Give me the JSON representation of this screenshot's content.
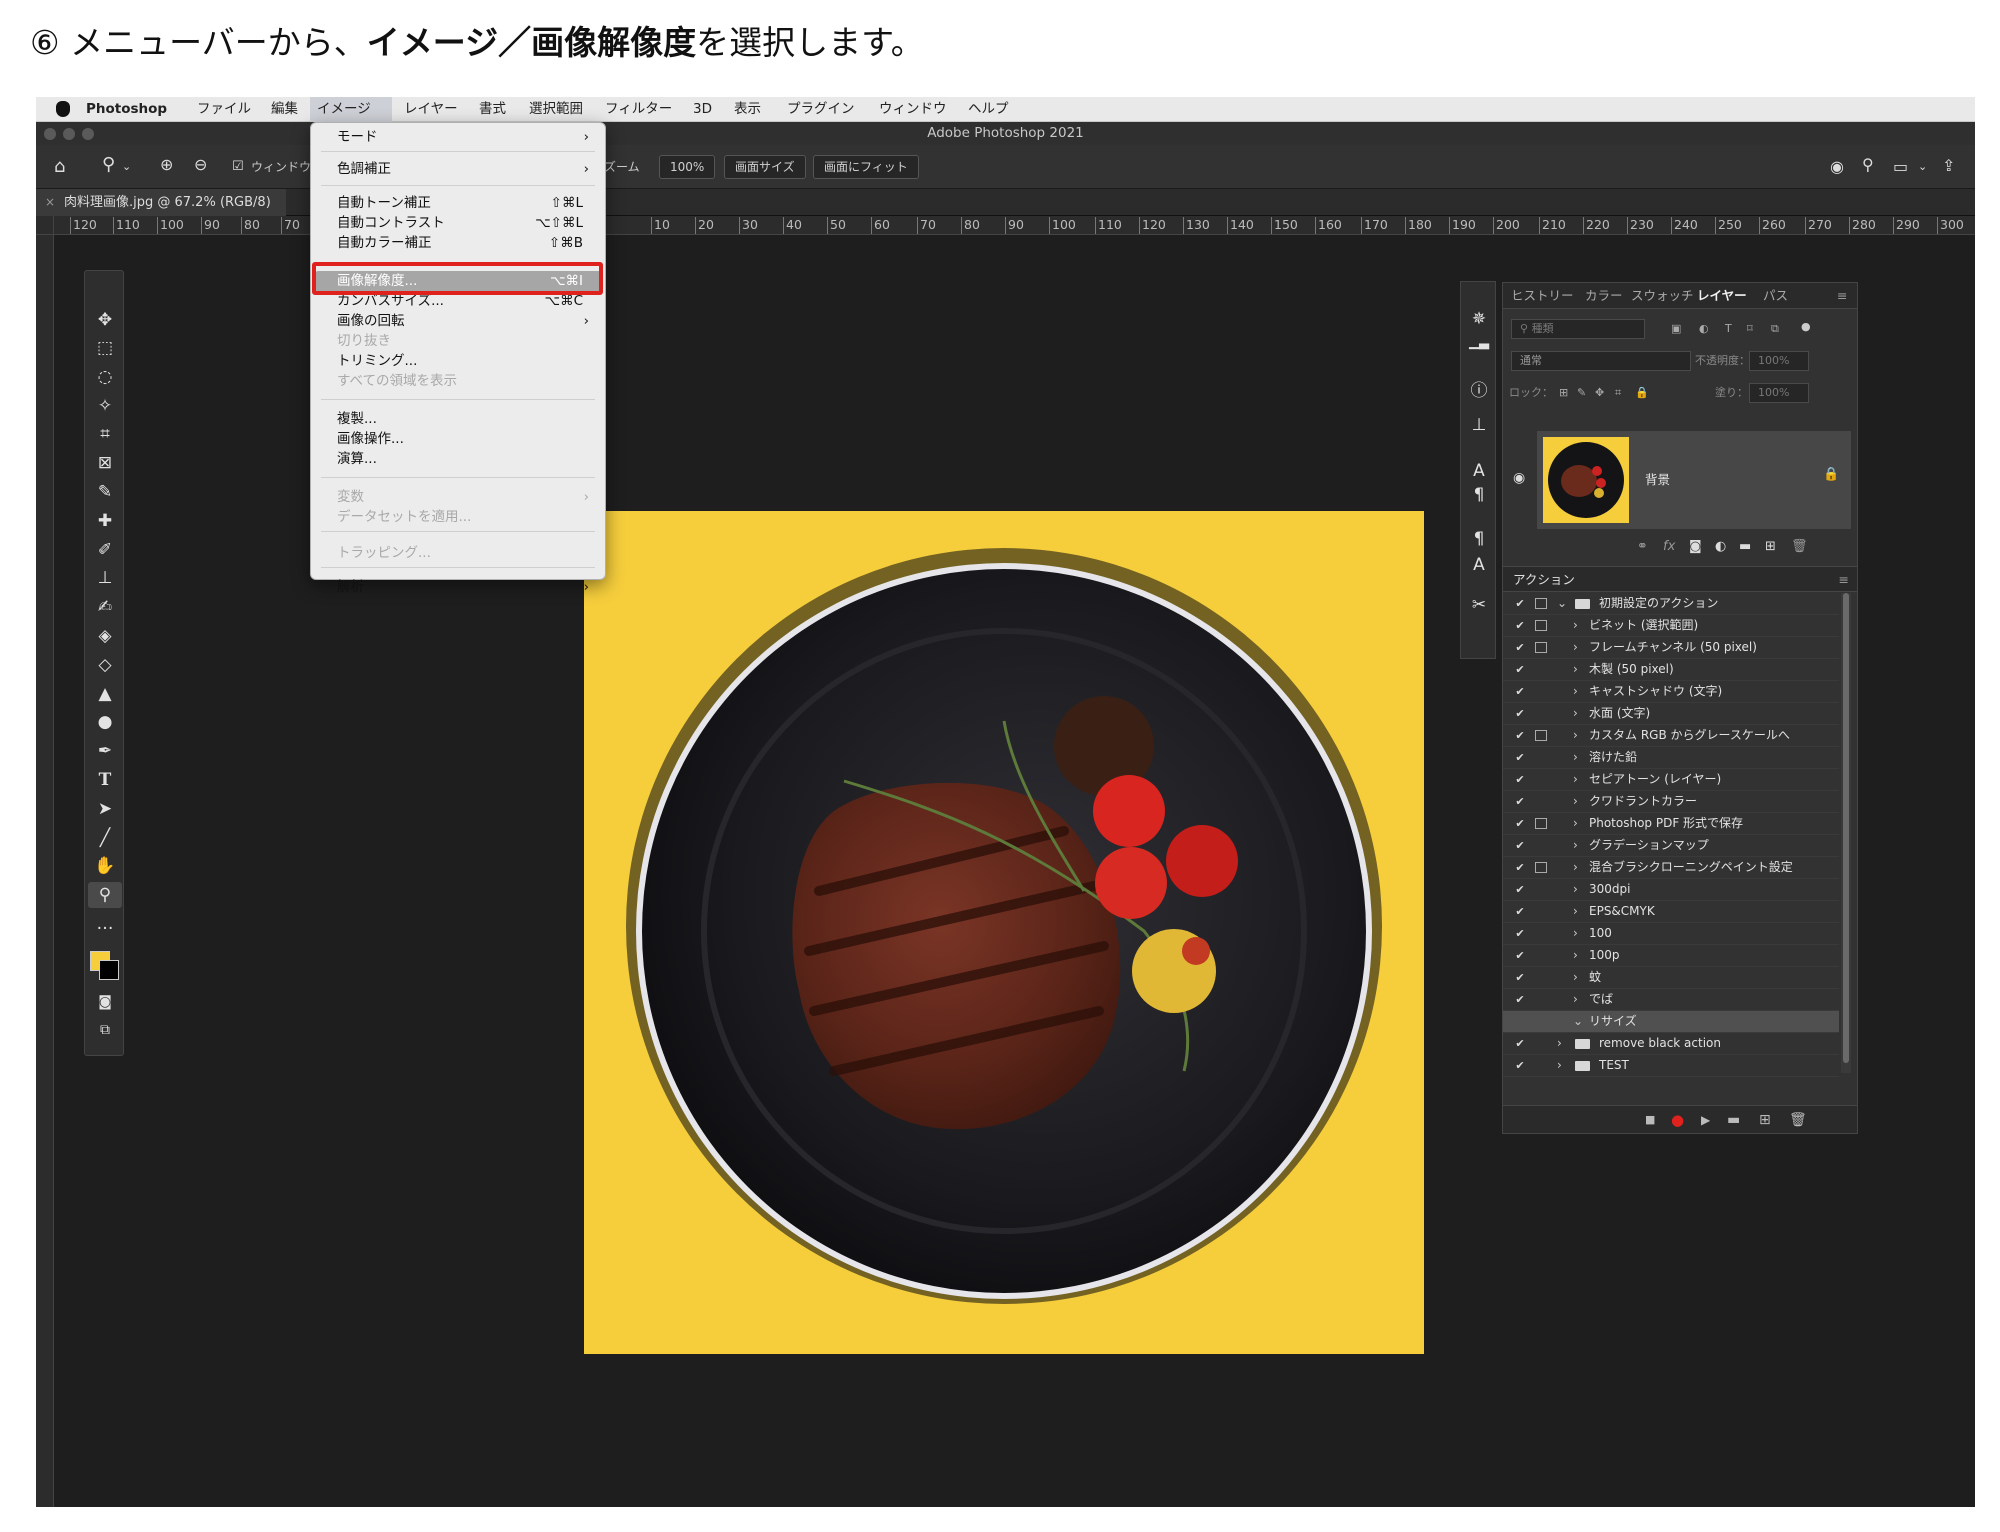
{
  "caption": {
    "prefix": "⑥ メニューバーから、",
    "highlight": "イメージ／画像解像度",
    "suffix": "を選択します。"
  },
  "mac_menubar": {
    "app": "Photoshop",
    "items": [
      "ファイル",
      "編集",
      "イメージ",
      "レイヤー",
      "書式",
      "選択範囲",
      "フィルター",
      "3D",
      "表示",
      "プラグイン",
      "ウィンドウ",
      "ヘルプ"
    ],
    "active": "イメージ"
  },
  "window_title": "Adobe Photoshop 2021",
  "options_bar": {
    "window_label": "ウィンドウ",
    "zoom_label": "ズーム",
    "zoom_value": "100%",
    "btn_image_size": "画面サイズ",
    "btn_fit": "画面にフィット"
  },
  "document_tab": "肉料理画像.jpg @ 67.2% (RGB/8)",
  "ruler_h": [
    "120",
    "110",
    "100",
    "90",
    "80",
    "70",
    "10",
    "20",
    "30",
    "40",
    "50",
    "60",
    "70",
    "80",
    "90",
    "100",
    "110",
    "120",
    "130",
    "140",
    "150",
    "160",
    "170",
    "180",
    "190",
    "200",
    "210",
    "220",
    "230",
    "240",
    "250",
    "260",
    "270",
    "280",
    "290",
    "300"
  ],
  "image_menu": {
    "items": [
      {
        "label": "モード",
        "arrow": "›"
      },
      {
        "label": "色調補正",
        "arrow": "›"
      },
      {
        "label": "自動トーン補正",
        "shortcut": "⇧⌘L"
      },
      {
        "label": "自動コントラスト",
        "shortcut": "⌥⇧⌘L"
      },
      {
        "label": "自動カラー補正",
        "shortcut": "⇧⌘B"
      },
      {
        "label": "画像解像度...",
        "shortcut": "⌥⌘I"
      },
      {
        "label": "カンバスサイズ...",
        "shortcut": "⌥⌘C"
      },
      {
        "label": "画像の回転",
        "arrow": "›"
      },
      {
        "label": "切り抜き"
      },
      {
        "label": "トリミング..."
      },
      {
        "label": "すべての領域を表示"
      },
      {
        "label": "複製..."
      },
      {
        "label": "画像操作..."
      },
      {
        "label": "演算..."
      },
      {
        "label": "変数",
        "arrow": "›"
      },
      {
        "label": "データセットを適用..."
      },
      {
        "label": "トラッピング..."
      },
      {
        "label": "解析",
        "arrow": "›"
      }
    ]
  },
  "panel": {
    "tabs": [
      "ヒストリー",
      "カラー",
      "スウォッチ",
      "レイヤー",
      "パス"
    ],
    "active_tab": "レイヤー",
    "search_placeholder": "種類",
    "blend_mode": "通常",
    "opacity_label": "不透明度：",
    "opacity_value": "100%",
    "lock_label": "ロック：",
    "fill_label": "塗り：",
    "fill_value": "100%",
    "layer_name": "背景",
    "actions_title": "アクション",
    "actions": [
      {
        "label": "初期設定のアクション",
        "folder": true,
        "open": true,
        "dialog": true
      },
      {
        "label": "ビネット (選択範囲)",
        "dialog": true
      },
      {
        "label": "フレームチャンネル (50 pixel)",
        "dialog": true
      },
      {
        "label": "木製 (50 pixel)"
      },
      {
        "label": "キャストシャドウ (文字)"
      },
      {
        "label": "水面 (文字)"
      },
      {
        "label": "カスタム RGB からグレースケールへ",
        "dialog": true
      },
      {
        "label": "溶けた鉛"
      },
      {
        "label": "セピアトーン (レイヤー)"
      },
      {
        "label": "クワドラントカラー"
      },
      {
        "label": "Photoshop PDF 形式で保存",
        "dialog": true
      },
      {
        "label": "グラデーションマップ"
      },
      {
        "label": "混合ブラシクローニングペイント設定",
        "dialog": true
      },
      {
        "label": "300dpi"
      },
      {
        "label": "EPS&CMYK"
      },
      {
        "label": "100"
      },
      {
        "label": "100p"
      },
      {
        "label": "蚊"
      },
      {
        "label": "でば"
      },
      {
        "label": "リサイズ",
        "open": true,
        "selected": true,
        "unchecked": true
      },
      {
        "label": "remove black action",
        "folder": true
      },
      {
        "label": "TEST",
        "folder": true
      }
    ]
  },
  "colors": {
    "canvas_bg": "#1e1e1e",
    "doc_bg": "#f6ce3c",
    "highlight_box": "#e0221e",
    "foreground": "#f6ce3c",
    "background": "#000000"
  }
}
